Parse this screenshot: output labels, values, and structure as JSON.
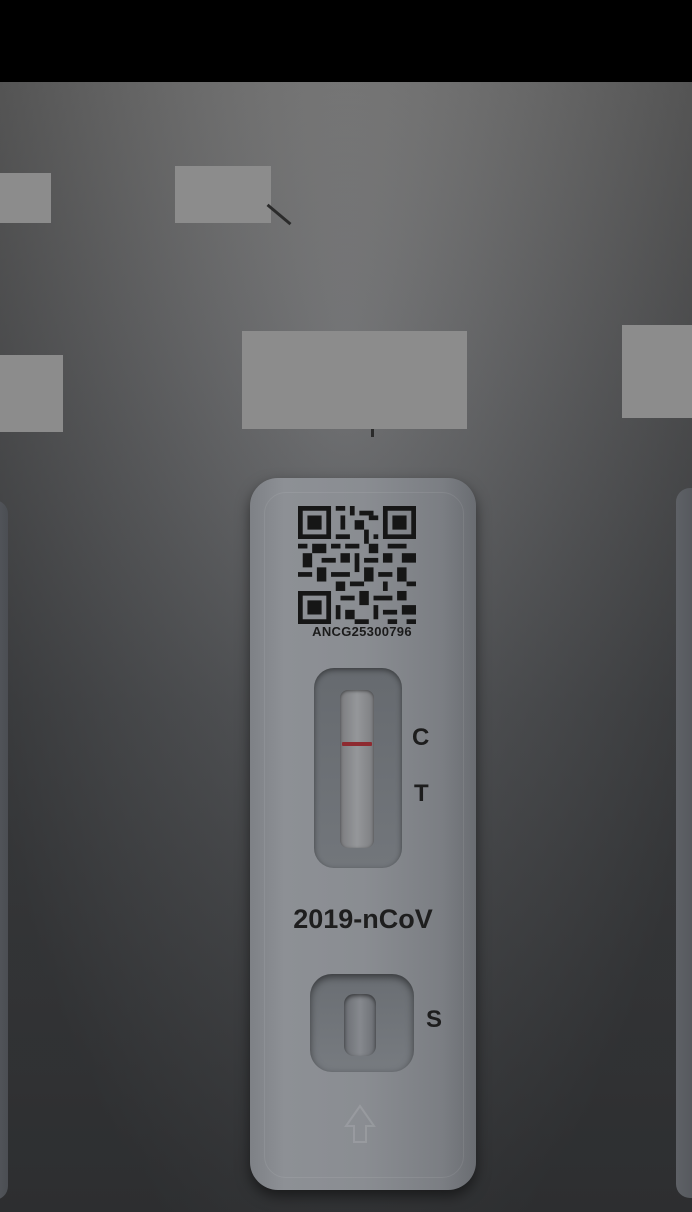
{
  "test_cassette": {
    "lot_code": "ANCG25300796",
    "line_labels": {
      "control": "C",
      "test": "T"
    },
    "product_name": "2019-nCoV",
    "sample_label": "S"
  },
  "colors": {
    "control_line": "#8e2a30",
    "redaction": "#8c8c8c",
    "cassette": "#8a8d92"
  }
}
